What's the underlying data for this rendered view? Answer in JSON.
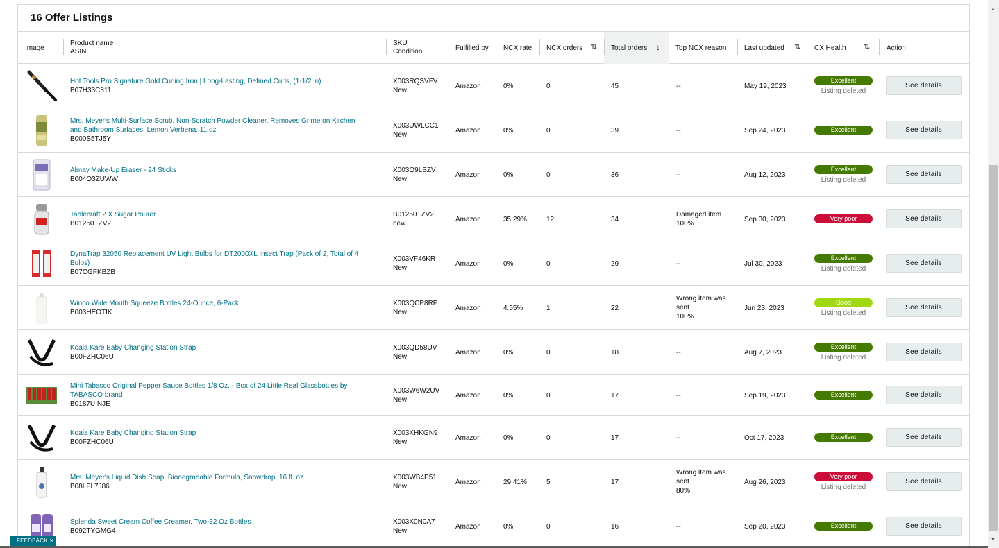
{
  "title": "16 Offer Listings",
  "headers": {
    "image": "Image",
    "product_name": "Product name",
    "asin": "ASIN",
    "sku": "SKU",
    "condition": "Condition",
    "fulfilled_by": "Fulfilled by",
    "ncx_rate": "NCX rate",
    "ncx_orders": "NCX orders",
    "total_orders": "Total orders",
    "top_ncx_reason": "Top NCX reason",
    "last_updated": "Last updated",
    "cx_health": "CX Health",
    "action": "Action"
  },
  "rows": [
    {
      "product": "Hot Tools Pro Signature Gold Curling Iron | Long-Lasting, Defined Curls, (1-1/2 in)",
      "product2": "",
      "asin": "B07H33C811",
      "sku": "X003RQSVFV",
      "condition": "New",
      "fulfilled": "Amazon",
      "ncx_rate": "0%",
      "ncx_orders": "0",
      "total": "45",
      "reason1": "--",
      "reason2": "",
      "reason3": "",
      "updated": "May 19, 2023",
      "health": "Excellent",
      "health_color": "#457a00",
      "deleted": "Listing deleted",
      "action": "See details",
      "icon": "curling-iron-image"
    },
    {
      "product": "Mrs. Meyer's Multi-Surface Scrub, Non-Scratch Powder Cleaner, Removes Grime on Kitchen",
      "product2": "and Bathroom Surfaces, Lemon Verbena, 11 oz",
      "asin": "B000S5TJ5Y",
      "sku": "X003UWLCC1",
      "condition": "New",
      "fulfilled": "Amazon",
      "ncx_rate": "0%",
      "ncx_orders": "0",
      "total": "39",
      "reason1": "--",
      "reason2": "",
      "reason3": "",
      "updated": "Sep 24, 2023",
      "health": "Excellent",
      "health_color": "#457a00",
      "deleted": "",
      "action": "See details",
      "icon": "cleaner-can-image"
    },
    {
      "product": "Almay Make-Up Eraser - 24 Sticks",
      "product2": "",
      "asin": "B004O3ZUWW",
      "sku": "X003Q9LBZV",
      "condition": "New",
      "fulfilled": "Amazon",
      "ncx_rate": "0%",
      "ncx_orders": "0",
      "total": "36",
      "reason1": "--",
      "reason2": "",
      "reason3": "",
      "updated": "Aug 12, 2023",
      "health": "Excellent",
      "health_color": "#457a00",
      "deleted": "Listing deleted",
      "action": "See details",
      "icon": "makeup-eraser-image"
    },
    {
      "product": "Tablecraft 2 X Sugar Pourer",
      "product2": "",
      "asin": "B01250TZV2",
      "sku": "B01250TZV2",
      "condition": "new",
      "fulfilled": "Amazon",
      "ncx_rate": "35.29%",
      "ncx_orders": "12",
      "total": "34",
      "reason1": "Damaged item",
      "reason2": "100%",
      "reason3": "",
      "updated": "Sep 30, 2023",
      "health": "Very poor",
      "health_color": "#cc0c39",
      "deleted": "",
      "action": "See details",
      "icon": "sugar-pourer-image"
    },
    {
      "product": "DynaTrap 32050 Replacement UV Light Bulbs for DT2000XL Insect Trap (Pack of 2, Total of 4",
      "product2": "Bulbs)",
      "asin": "B07CGFKBZB",
      "sku": "X003VF46KR",
      "condition": "New",
      "fulfilled": "Amazon",
      "ncx_rate": "0%",
      "ncx_orders": "0",
      "total": "29",
      "reason1": "--",
      "reason2": "",
      "reason3": "",
      "updated": "Jul 30, 2023",
      "health": "Excellent",
      "health_color": "#457a00",
      "deleted": "Listing deleted",
      "action": "See details",
      "icon": "light-bulbs-image"
    },
    {
      "product": "Winco Wide Mouth Squeeze Bottles 24-Ounce, 6-Pack",
      "product2": "",
      "asin": "B003HEOTIK",
      "sku": "X003QCP8RF",
      "condition": "New",
      "fulfilled": "Amazon",
      "ncx_rate": "4.55%",
      "ncx_orders": "1",
      "total": "22",
      "reason1": "Wrong item was",
      "reason2": "sent",
      "reason3": "100%",
      "updated": "Jun 23, 2023",
      "health": "Good",
      "health_color": "#a0d911",
      "deleted": "Listing deleted",
      "action": "See details",
      "icon": "squeeze-bottle-image"
    },
    {
      "product": "Koala Kare Baby Changing Station Strap",
      "product2": "",
      "asin": "B00FZHC06U",
      "sku": "X003QD58UV",
      "condition": "New",
      "fulfilled": "Amazon",
      "ncx_rate": "0%",
      "ncx_orders": "0",
      "total": "18",
      "reason1": "--",
      "reason2": "",
      "reason3": "",
      "updated": "Aug 7, 2023",
      "health": "Excellent",
      "health_color": "#457a00",
      "deleted": "Listing deleted",
      "action": "See details",
      "icon": "strap-image"
    },
    {
      "product": "Mini Tabasco Original Pepper Sauce Bottles 1/8 Oz. - Box of 24 Little Real Glassbottles by",
      "product2": "TABASCO brand",
      "asin": "B0187UINJE",
      "sku": "X003W6W2UV",
      "condition": "New",
      "fulfilled": "Amazon",
      "ncx_rate": "0%",
      "ncx_orders": "0",
      "total": "17",
      "reason1": "--",
      "reason2": "",
      "reason3": "",
      "updated": "Sep 19, 2023",
      "health": "Excellent",
      "health_color": "#457a00",
      "deleted": "",
      "action": "See details",
      "icon": "tabasco-bottles-image"
    },
    {
      "product": "Koala Kare Baby Changing Station Strap",
      "product2": "",
      "asin": "B00FZHC06U",
      "sku": "X003XHKGN9",
      "condition": "New",
      "fulfilled": "Amazon",
      "ncx_rate": "0%",
      "ncx_orders": "0",
      "total": "17",
      "reason1": "--",
      "reason2": "",
      "reason3": "",
      "updated": "Oct 17, 2023",
      "health": "Excellent",
      "health_color": "#457a00",
      "deleted": "",
      "action": "See details",
      "icon": "strap-image"
    },
    {
      "product": "Mrs. Meyer's Liquid Dish Soap, Biodegradable Formula, Snowdrop, 16 fl. oz",
      "product2": "",
      "asin": "B08LFL7J86",
      "sku": "X003WB4P51",
      "condition": "New",
      "fulfilled": "Amazon",
      "ncx_rate": "29.41%",
      "ncx_orders": "5",
      "total": "17",
      "reason1": "Wrong item was",
      "reason2": "sent",
      "reason3": "80%",
      "updated": "Aug 26, 2023",
      "health": "Very poor",
      "health_color": "#cc0c39",
      "deleted": "Listing deleted",
      "action": "See details",
      "icon": "dish-soap-image"
    },
    {
      "product": "Splenda Sweet Cream Coffee Creamer, Two-32 Oz Bottles",
      "product2": "",
      "asin": "B092TYGMG4",
      "sku": "X003X0N0A7",
      "condition": "New",
      "fulfilled": "Amazon",
      "ncx_rate": "0%",
      "ncx_orders": "0",
      "total": "16",
      "reason1": "--",
      "reason2": "",
      "reason3": "",
      "updated": "Sep 20, 2023",
      "health": "Excellent",
      "health_color": "#457a00",
      "deleted": "",
      "action": "See details",
      "icon": "creamer-bottles-image"
    }
  ],
  "feedback": "FEEDBACK ✕"
}
